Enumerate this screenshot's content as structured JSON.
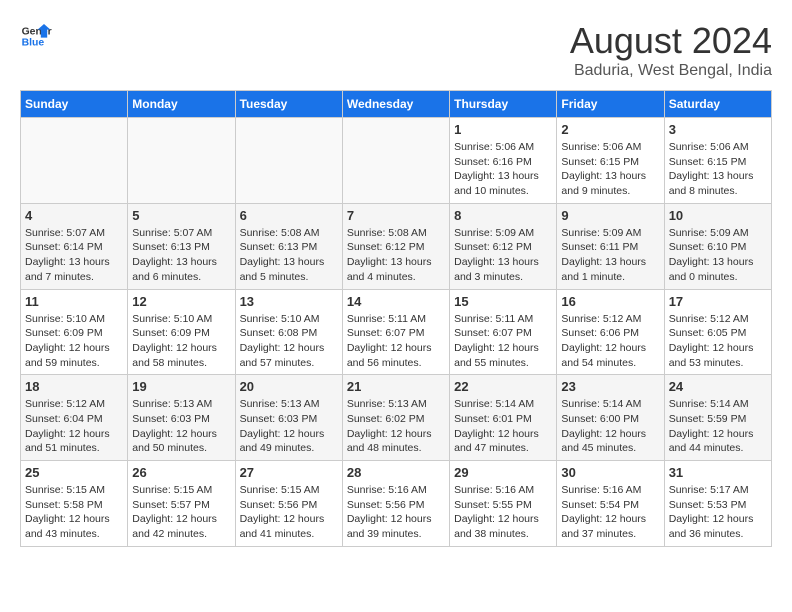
{
  "logo": {
    "line1": "General",
    "line2": "Blue"
  },
  "title": "August 2024",
  "subtitle": "Baduria, West Bengal, India",
  "days_of_week": [
    "Sunday",
    "Monday",
    "Tuesday",
    "Wednesday",
    "Thursday",
    "Friday",
    "Saturday"
  ],
  "weeks": [
    [
      {
        "day": "",
        "info": ""
      },
      {
        "day": "",
        "info": ""
      },
      {
        "day": "",
        "info": ""
      },
      {
        "day": "",
        "info": ""
      },
      {
        "day": "1",
        "info": "Sunrise: 5:06 AM\nSunset: 6:16 PM\nDaylight: 13 hours\nand 10 minutes."
      },
      {
        "day": "2",
        "info": "Sunrise: 5:06 AM\nSunset: 6:15 PM\nDaylight: 13 hours\nand 9 minutes."
      },
      {
        "day": "3",
        "info": "Sunrise: 5:06 AM\nSunset: 6:15 PM\nDaylight: 13 hours\nand 8 minutes."
      }
    ],
    [
      {
        "day": "4",
        "info": "Sunrise: 5:07 AM\nSunset: 6:14 PM\nDaylight: 13 hours\nand 7 minutes."
      },
      {
        "day": "5",
        "info": "Sunrise: 5:07 AM\nSunset: 6:13 PM\nDaylight: 13 hours\nand 6 minutes."
      },
      {
        "day": "6",
        "info": "Sunrise: 5:08 AM\nSunset: 6:13 PM\nDaylight: 13 hours\nand 5 minutes."
      },
      {
        "day": "7",
        "info": "Sunrise: 5:08 AM\nSunset: 6:12 PM\nDaylight: 13 hours\nand 4 minutes."
      },
      {
        "day": "8",
        "info": "Sunrise: 5:09 AM\nSunset: 6:12 PM\nDaylight: 13 hours\nand 3 minutes."
      },
      {
        "day": "9",
        "info": "Sunrise: 5:09 AM\nSunset: 6:11 PM\nDaylight: 13 hours\nand 1 minute."
      },
      {
        "day": "10",
        "info": "Sunrise: 5:09 AM\nSunset: 6:10 PM\nDaylight: 13 hours\nand 0 minutes."
      }
    ],
    [
      {
        "day": "11",
        "info": "Sunrise: 5:10 AM\nSunset: 6:09 PM\nDaylight: 12 hours\nand 59 minutes."
      },
      {
        "day": "12",
        "info": "Sunrise: 5:10 AM\nSunset: 6:09 PM\nDaylight: 12 hours\nand 58 minutes."
      },
      {
        "day": "13",
        "info": "Sunrise: 5:10 AM\nSunset: 6:08 PM\nDaylight: 12 hours\nand 57 minutes."
      },
      {
        "day": "14",
        "info": "Sunrise: 5:11 AM\nSunset: 6:07 PM\nDaylight: 12 hours\nand 56 minutes."
      },
      {
        "day": "15",
        "info": "Sunrise: 5:11 AM\nSunset: 6:07 PM\nDaylight: 12 hours\nand 55 minutes."
      },
      {
        "day": "16",
        "info": "Sunrise: 5:12 AM\nSunset: 6:06 PM\nDaylight: 12 hours\nand 54 minutes."
      },
      {
        "day": "17",
        "info": "Sunrise: 5:12 AM\nSunset: 6:05 PM\nDaylight: 12 hours\nand 53 minutes."
      }
    ],
    [
      {
        "day": "18",
        "info": "Sunrise: 5:12 AM\nSunset: 6:04 PM\nDaylight: 12 hours\nand 51 minutes."
      },
      {
        "day": "19",
        "info": "Sunrise: 5:13 AM\nSunset: 6:03 PM\nDaylight: 12 hours\nand 50 minutes."
      },
      {
        "day": "20",
        "info": "Sunrise: 5:13 AM\nSunset: 6:03 PM\nDaylight: 12 hours\nand 49 minutes."
      },
      {
        "day": "21",
        "info": "Sunrise: 5:13 AM\nSunset: 6:02 PM\nDaylight: 12 hours\nand 48 minutes."
      },
      {
        "day": "22",
        "info": "Sunrise: 5:14 AM\nSunset: 6:01 PM\nDaylight: 12 hours\nand 47 minutes."
      },
      {
        "day": "23",
        "info": "Sunrise: 5:14 AM\nSunset: 6:00 PM\nDaylight: 12 hours\nand 45 minutes."
      },
      {
        "day": "24",
        "info": "Sunrise: 5:14 AM\nSunset: 5:59 PM\nDaylight: 12 hours\nand 44 minutes."
      }
    ],
    [
      {
        "day": "25",
        "info": "Sunrise: 5:15 AM\nSunset: 5:58 PM\nDaylight: 12 hours\nand 43 minutes."
      },
      {
        "day": "26",
        "info": "Sunrise: 5:15 AM\nSunset: 5:57 PM\nDaylight: 12 hours\nand 42 minutes."
      },
      {
        "day": "27",
        "info": "Sunrise: 5:15 AM\nSunset: 5:56 PM\nDaylight: 12 hours\nand 41 minutes."
      },
      {
        "day": "28",
        "info": "Sunrise: 5:16 AM\nSunset: 5:56 PM\nDaylight: 12 hours\nand 39 minutes."
      },
      {
        "day": "29",
        "info": "Sunrise: 5:16 AM\nSunset: 5:55 PM\nDaylight: 12 hours\nand 38 minutes."
      },
      {
        "day": "30",
        "info": "Sunrise: 5:16 AM\nSunset: 5:54 PM\nDaylight: 12 hours\nand 37 minutes."
      },
      {
        "day": "31",
        "info": "Sunrise: 5:17 AM\nSunset: 5:53 PM\nDaylight: 12 hours\nand 36 minutes."
      }
    ]
  ]
}
